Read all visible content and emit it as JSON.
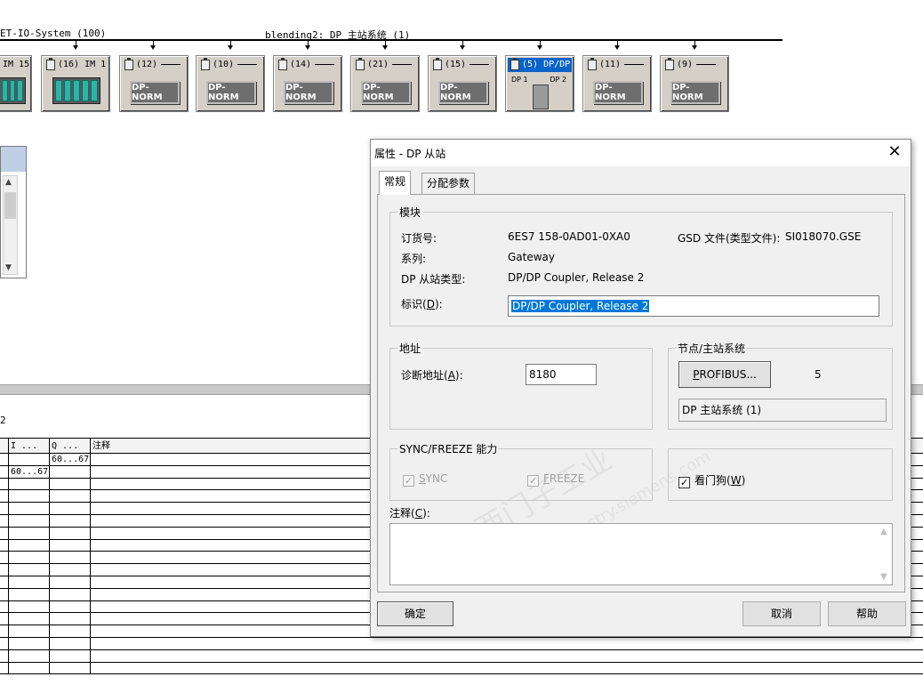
{
  "network": {
    "left_label": "ET-IO-System (100)",
    "center_label": "blending2: DP 主站系统 (1)",
    "stations": [
      {
        "label": "IM 15",
        "kind": "rack"
      },
      {
        "label": "(16) IM 1",
        "kind": "rack"
      },
      {
        "label": "(12)",
        "kind": "dpnorm",
        "module": "DP-NORM"
      },
      {
        "label": "(10)",
        "kind": "dpnorm",
        "module": "DP-NORM"
      },
      {
        "label": "(14)",
        "kind": "dpnorm",
        "module": "DP-NORM"
      },
      {
        "label": "(21)",
        "kind": "dpnorm",
        "module": "DP-NORM"
      },
      {
        "label": "(15)",
        "kind": "dpnorm",
        "module": "DP-NORM"
      },
      {
        "label": "(5) DP/DP",
        "kind": "coupler",
        "dp1": "DP 1",
        "dp2": "DP 2",
        "selected": true
      },
      {
        "label": "(11)",
        "kind": "dpnorm",
        "module": "DP-NORM"
      },
      {
        "label": "(9)",
        "kind": "dpnorm",
        "module": "DP-NORM"
      }
    ]
  },
  "table": {
    "caption": "2",
    "headers": [
      "",
      "I ...",
      "Q ...",
      "注释"
    ],
    "rows": [
      [
        "",
        "",
        "60...67",
        ""
      ],
      [
        "",
        "60...67",
        "",
        ""
      ],
      [
        "",
        "",
        "",
        ""
      ],
      [
        "",
        "",
        "",
        ""
      ],
      [
        "",
        "",
        "",
        ""
      ],
      [
        "",
        "",
        "",
        ""
      ],
      [
        "",
        "",
        "",
        ""
      ],
      [
        "",
        "",
        "",
        ""
      ],
      [
        "",
        "",
        "",
        ""
      ],
      [
        "",
        "",
        "",
        ""
      ],
      [
        "",
        "",
        "",
        ""
      ],
      [
        "",
        "",
        "",
        ""
      ],
      [
        "",
        "",
        "",
        ""
      ],
      [
        "",
        "",
        "",
        ""
      ],
      [
        "",
        "",
        "",
        ""
      ],
      [
        "",
        "",
        "",
        ""
      ],
      [
        "",
        "",
        "",
        ""
      ],
      [
        "",
        "",
        "",
        ""
      ]
    ]
  },
  "dialog": {
    "title": "属性 - DP 从站",
    "close_glyph": "✕",
    "tabs": [
      "常规",
      "分配参数"
    ],
    "module": {
      "legend": "模块",
      "order_no_label": "订货号:",
      "order_no_value": "6ES7 158-0AD01-0XA0",
      "gsd_label": "GSD 文件(类型文件):",
      "gsd_value": "SI018070.GSE",
      "family_label": "系列:",
      "family_value": "Gateway",
      "slave_type_label": "DP 从站类型:",
      "slave_type_value": "DP/DP Coupler, Release 2",
      "designation_label_pre": "标识(",
      "designation_label_key": "D",
      "designation_label_post": "):",
      "designation_value": "DP/DP Coupler, Release 2"
    },
    "address": {
      "legend": "地址",
      "diag_label_pre": "诊断地址(",
      "diag_label_key": "A",
      "diag_label_post": "):",
      "diag_value": "8180"
    },
    "node": {
      "legend": "节点/主站系统",
      "profibus_key": "P",
      "profibus_rest": "ROFIBUS...",
      "node_value": "5",
      "master_system": "DP 主站系统 (1)"
    },
    "sync_freeze": {
      "legend": "SYNC/FREEZE 能力",
      "sync_key": "S",
      "sync_rest": "YNC",
      "freeze_key": "F",
      "freeze_rest": "REEZE",
      "check_glyph": "✓"
    },
    "watchdog": {
      "label_pre": "看门狗(",
      "label_key": "W",
      "label_post": ")"
    },
    "comment": {
      "label_pre": "注释(",
      "label_key": "C",
      "label_post": "):"
    },
    "buttons": {
      "ok": "确定",
      "cancel": "取消",
      "help": "帮助"
    },
    "watermark_1": "西门子工业",
    "watermark_2": "support.industry.siemens.com"
  },
  "colors": {
    "selection": "#0078d7",
    "station_selected": "#0a64c8",
    "rack_module": "#2fb3a6"
  }
}
